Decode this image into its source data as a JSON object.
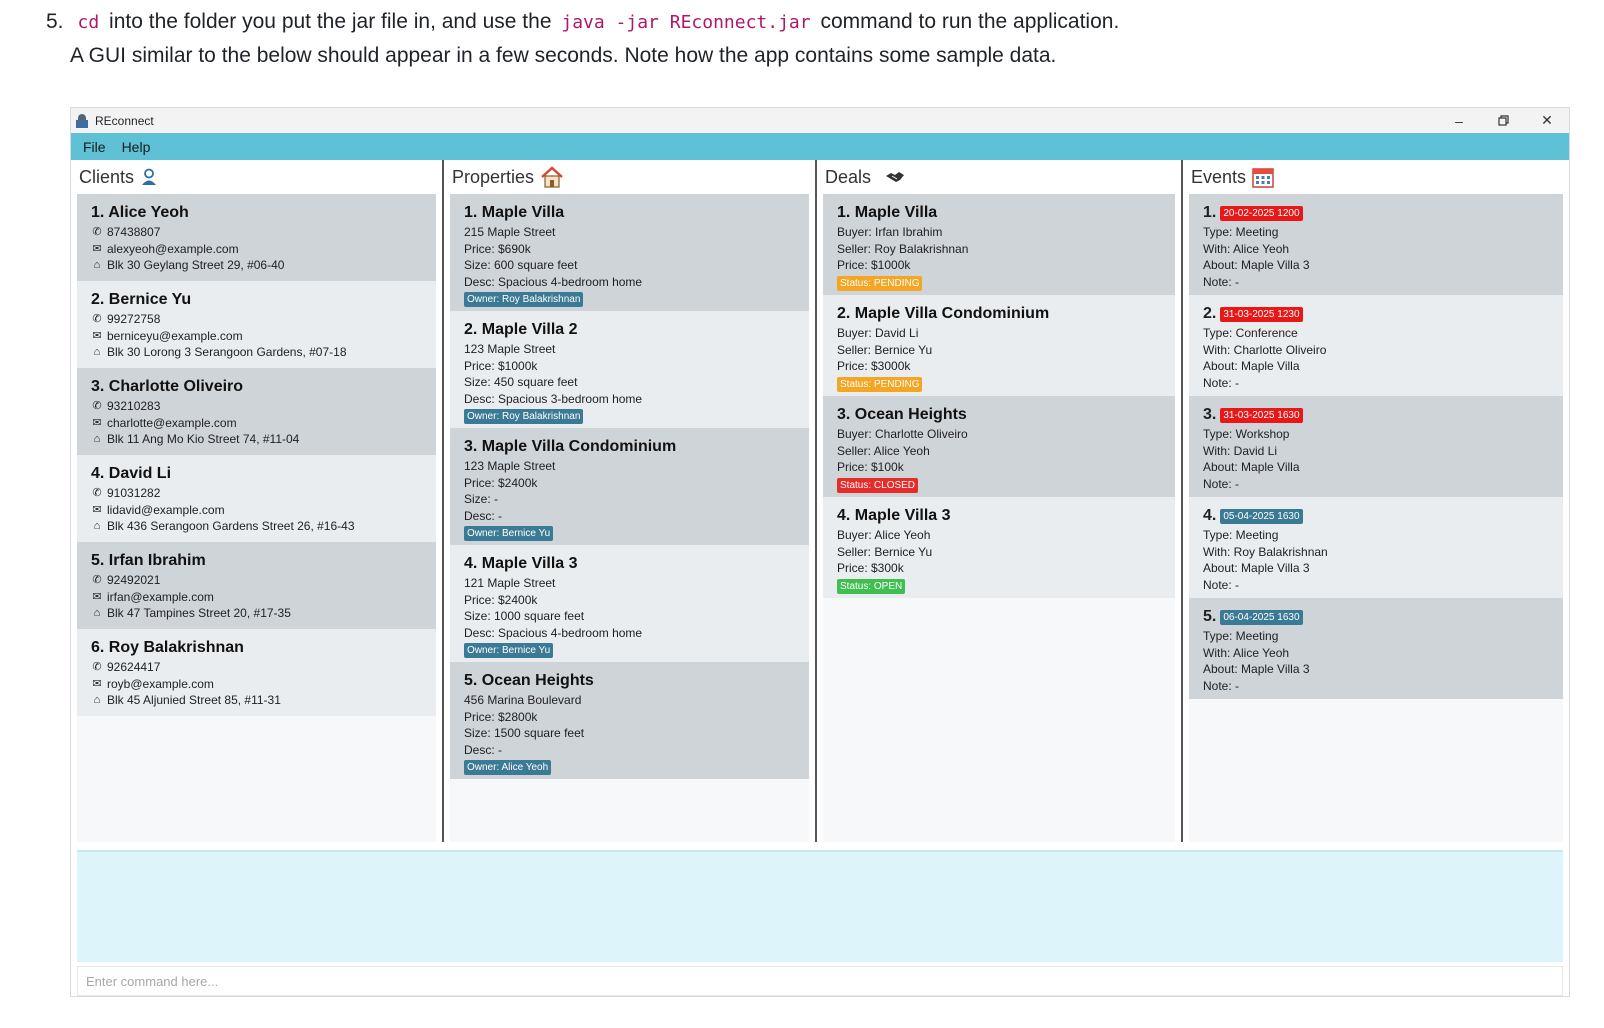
{
  "doc": {
    "step_num": "5.",
    "code_cd": "cd",
    "text_a": "into the folder you put the jar file in, and use the",
    "code_cmd": "java -jar REconnect.jar",
    "text_b": "command to run the application.",
    "line2": "A GUI similar to the below should appear in a few seconds. Note how the app contains some sample data."
  },
  "window": {
    "title": "REconnect",
    "menu": [
      "File",
      "Help"
    ]
  },
  "panels": {
    "clients": {
      "title": "Clients",
      "items": [
        {
          "name": "1. Alice Yeoh",
          "phone": "87438807",
          "email": "alexyeoh@example.com",
          "address": "Blk 30 Geylang Street 29, #06-40"
        },
        {
          "name": "2. Bernice Yu",
          "phone": "99272758",
          "email": "berniceyu@example.com",
          "address": "Blk 30 Lorong 3 Serangoon Gardens, #07-18"
        },
        {
          "name": "3. Charlotte Oliveiro",
          "phone": "93210283",
          "email": "charlotte@example.com",
          "address": "Blk 11 Ang Mo Kio Street 74, #11-04"
        },
        {
          "name": "4. David Li",
          "phone": "91031282",
          "email": "lidavid@example.com",
          "address": "Blk 436 Serangoon Gardens Street 26, #16-43"
        },
        {
          "name": "5. Irfan Ibrahim",
          "phone": "92492021",
          "email": "irfan@example.com",
          "address": "Blk 47 Tampines Street 20, #17-35"
        },
        {
          "name": "6. Roy Balakrishnan",
          "phone": "92624417",
          "email": "royb@example.com",
          "address": "Blk 45 Aljunied Street 85, #11-31"
        }
      ]
    },
    "properties": {
      "title": "Properties",
      "items": [
        {
          "name": "1. Maple Villa",
          "address": "215 Maple Street",
          "price": "Price: $690k",
          "size": "Size: 600 square feet",
          "desc": "Desc: Spacious 4-bedroom home",
          "owner": "Owner: Roy Balakrishnan"
        },
        {
          "name": "2. Maple Villa 2",
          "address": "123 Maple Street",
          "price": "Price: $1000k",
          "size": "Size: 450 square feet",
          "desc": "Desc: Spacious 3-bedroom home",
          "owner": "Owner: Roy Balakrishnan"
        },
        {
          "name": "3. Maple Villa Condominium",
          "address": "123 Maple Street",
          "price": "Price: $2400k",
          "size": "Size: -",
          "desc": "Desc: -",
          "owner": "Owner: Bernice Yu"
        },
        {
          "name": "4. Maple Villa 3",
          "address": "121 Maple Street",
          "price": "Price: $2400k",
          "size": "Size: 1000 square feet",
          "desc": "Desc: Spacious 4-bedroom home",
          "owner": "Owner: Bernice Yu"
        },
        {
          "name": "5. Ocean Heights",
          "address": "456 Marina Boulevard",
          "price": "Price: $2800k",
          "size": "Size: 1500 square feet",
          "desc": "Desc: -",
          "owner": "Owner: Alice Yeoh"
        }
      ]
    },
    "deals": {
      "title": "Deals",
      "items": [
        {
          "name": "1. Maple Villa",
          "buyer": "Buyer: Irfan Ibrahim",
          "seller": "Seller: Roy Balakrishnan",
          "price": "Price: $1000k",
          "status": "Status: PENDING",
          "status_kind": "pending"
        },
        {
          "name": "2. Maple Villa Condominium",
          "buyer": "Buyer: David Li",
          "seller": "Seller: Bernice Yu",
          "price": "Price: $3000k",
          "status": "Status: PENDING",
          "status_kind": "pending"
        },
        {
          "name": "3. Ocean Heights",
          "buyer": "Buyer: Charlotte Oliveiro",
          "seller": "Seller: Alice Yeoh",
          "price": "Price: $100k",
          "status": "Status: CLOSED",
          "status_kind": "closed"
        },
        {
          "name": "4. Maple Villa 3",
          "buyer": "Buyer: Alice Yeoh",
          "seller": "Seller: Bernice Yu",
          "price": "Price: $300k",
          "status": "Status: OPEN",
          "status_kind": "open"
        }
      ]
    },
    "events": {
      "title": "Events",
      "items": [
        {
          "num": "1.",
          "datetime": "20-02-2025 1200",
          "date_kind": "past",
          "type": "Type: Meeting",
          "with": "With: Alice Yeoh",
          "about": "About: Maple Villa 3",
          "note": "Note: -"
        },
        {
          "num": "2.",
          "datetime": "31-03-2025 1230",
          "date_kind": "past",
          "type": "Type: Conference",
          "with": "With: Charlotte Oliveiro",
          "about": "About: Maple Villa",
          "note": "Note: -"
        },
        {
          "num": "3.",
          "datetime": "31-03-2025 1630",
          "date_kind": "past",
          "type": "Type: Workshop",
          "with": "With: David Li",
          "about": "About: Maple Villa",
          "note": "Note: -"
        },
        {
          "num": "4.",
          "datetime": "05-04-2025 1630",
          "date_kind": "future",
          "type": "Type: Meeting",
          "with": "With: Roy Balakrishnan",
          "about": "About: Maple Villa 3",
          "note": "Note: -"
        },
        {
          "num": "5.",
          "datetime": "06-04-2025 1630",
          "date_kind": "future",
          "type": "Type: Meeting",
          "with": "With: Alice Yeoh",
          "about": "About: Maple Villa 3",
          "note": "Note: -"
        }
      ]
    }
  },
  "command": {
    "placeholder": "Enter command here...",
    "value": ""
  },
  "icons": {
    "clients": "person-icon",
    "properties": "house-icon",
    "deals": "handshake-icon",
    "events": "calendar-icon",
    "phone": "phone-icon",
    "email": "envelope-icon",
    "address": "home-icon"
  },
  "colors": {
    "menubar": "#5fc1d6",
    "card_dark": "#cfd4d9",
    "card_light": "#eaedf0",
    "owner_tag": "#3b7a94",
    "pending": "#f5a524",
    "closed": "#e62b2b",
    "open": "#3fbf4f",
    "past_event": "#e81818",
    "result_box": "#dcf4fa"
  }
}
